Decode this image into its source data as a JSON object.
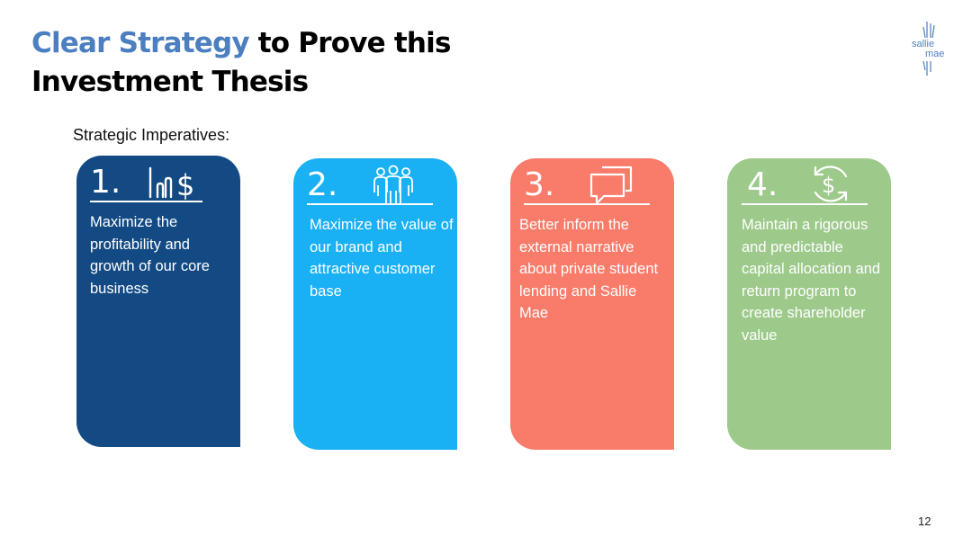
{
  "title": {
    "accent": "Clear Strategy",
    "rest_line1": " to Prove this",
    "line2": "Investment Thesis"
  },
  "logo": {
    "line1": "sallie",
    "line2": "mae"
  },
  "subtitle": "Strategic Imperatives:",
  "cards": [
    {
      "number": "1.",
      "icon": "bar-chart-dollar-icon",
      "text": "Maximize the profitability and growth of our core business",
      "color": "#144a83"
    },
    {
      "number": "2.",
      "icon": "people-group-icon",
      "text": "Maximize the value of our brand and attractive customer base",
      "color": "#1ab0f4"
    },
    {
      "number": "3.",
      "icon": "chat-bubbles-icon",
      "text": "Better inform the external narrative about private student lending and Sallie Mae",
      "color": "#f97b6a"
    },
    {
      "number": "4.",
      "icon": "dollar-cycle-icon",
      "text": "Maintain a rigorous and predictable capital allocation and return program to create shareholder value",
      "color": "#9dc98b"
    }
  ],
  "page_number": "12"
}
